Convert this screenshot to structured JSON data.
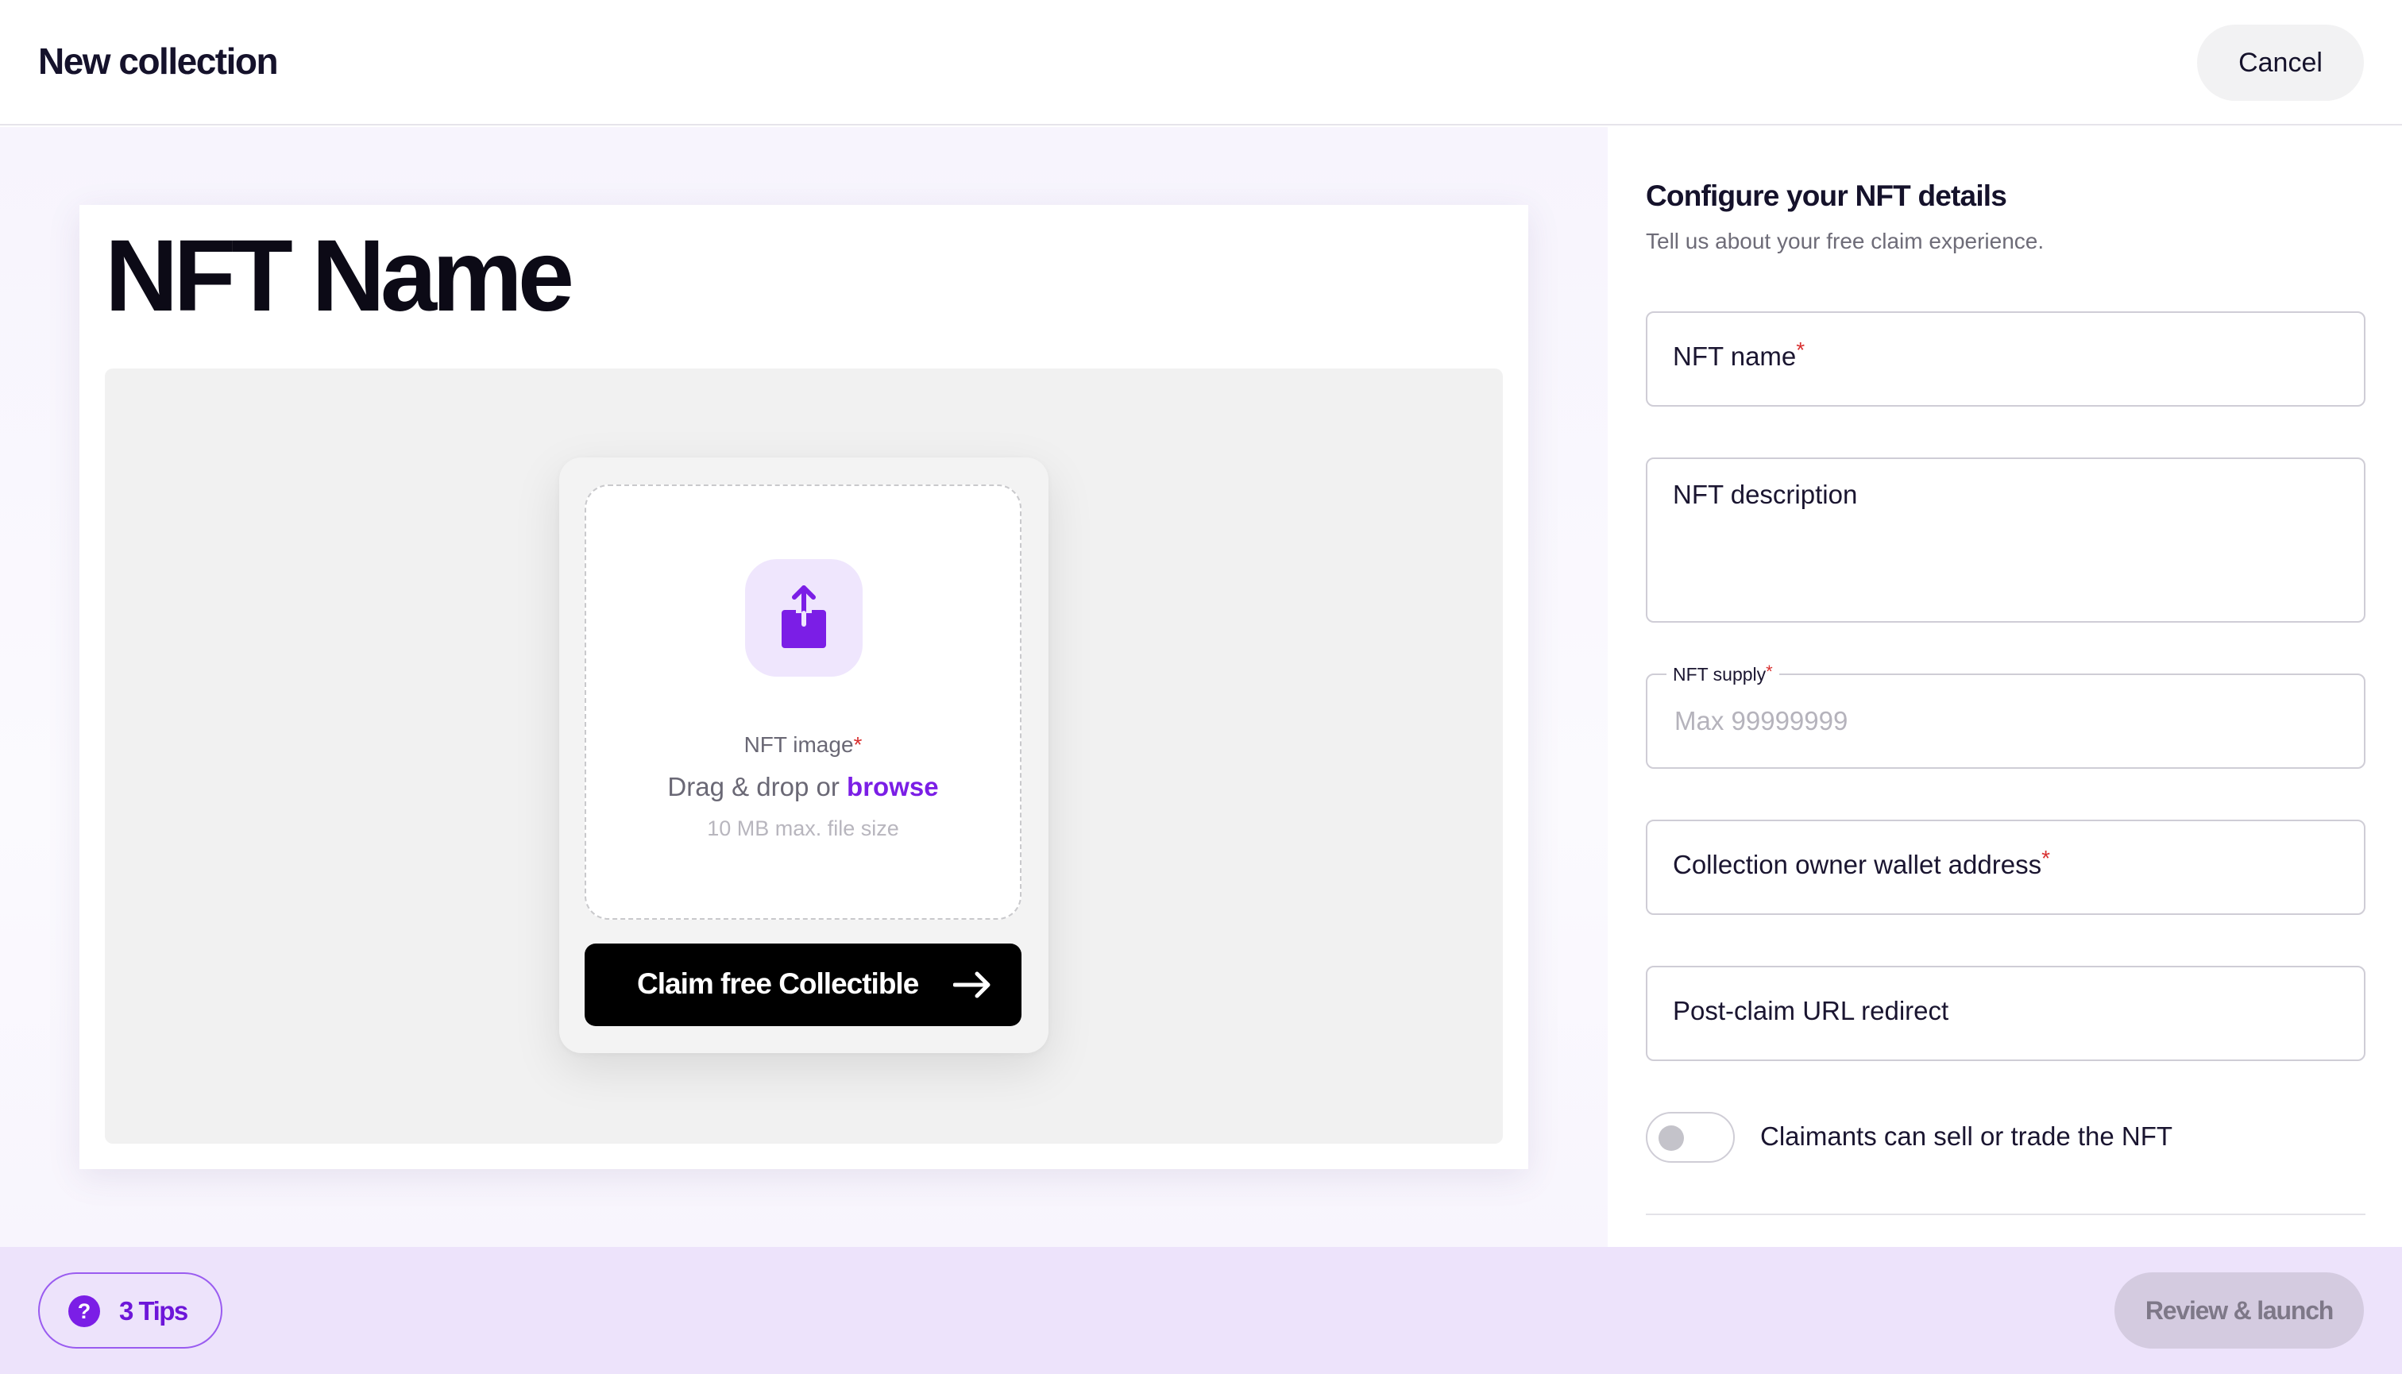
{
  "header": {
    "title": "New collection",
    "cancel_label": "Cancel"
  },
  "preview": {
    "nft_name": "NFT Name",
    "image_label": "NFT image",
    "required_mark": "*",
    "drag_drop_text": "Drag & drop or",
    "browse_label": "browse",
    "size_hint": "10 MB max. file size",
    "claim_button_label": "Claim free Collectible",
    "upload_icon": "upload-icon",
    "arrow_icon": "arrow-right-icon"
  },
  "form": {
    "heading": "Configure your NFT details",
    "subheading": "Tell us about your free claim experience.",
    "required_mark": "*",
    "fields": {
      "name_label": "NFT name",
      "description_label": "NFT description",
      "supply_label": "NFT supply",
      "supply_placeholder": "Max 99999999",
      "owner_label": "Collection owner wallet address",
      "redirect_label": "Post-claim URL redirect"
    },
    "toggle": {
      "label": "Claimants can sell or trade the NFT",
      "on": false
    }
  },
  "footer": {
    "tips_icon_glyph": "?",
    "tips_label": "3 Tips",
    "review_label": "Review & launch",
    "review_disabled": true
  },
  "colors": {
    "accent": "#7b1ee6",
    "footer_bg": "#ede3fb",
    "required": "#d83030"
  }
}
